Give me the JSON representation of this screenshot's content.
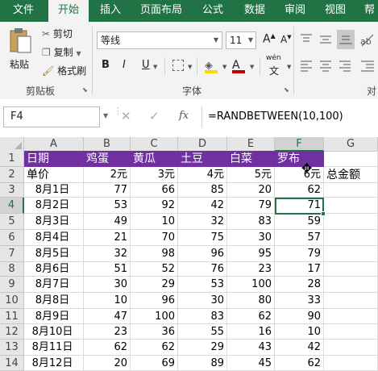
{
  "tabs": [
    "文件",
    "开始",
    "插入",
    "页面布局",
    "公式",
    "数据",
    "审阅",
    "视图",
    "帮"
  ],
  "active_tab": "开始",
  "ribbon": {
    "cut": "剪切",
    "copy": "复制",
    "format_painter": "格式刷",
    "paste": "粘贴",
    "clipboard_group": "剪贴板",
    "font_name": "等线",
    "font_size": "11",
    "grow_font": "A",
    "shrink_font": "A",
    "bold": "B",
    "italic": "I",
    "underline": "U",
    "font_color_glyph": "A",
    "wen": "wén",
    "font_group": "字体",
    "align_group": "对"
  },
  "formula_bar": {
    "name_box": "F4",
    "fx": "fx",
    "formula": "=RANDBETWEEN(10,100)"
  },
  "columns": [
    "A",
    "B",
    "C",
    "D",
    "E",
    "F",
    "G"
  ],
  "rows": [
    {
      "n": "1",
      "cells": [
        "日期",
        "鸡蛋",
        "黄瓜",
        "土豆",
        "白菜",
        "罗布",
        ""
      ]
    },
    {
      "n": "2",
      "cells": [
        "单价",
        "2元",
        "3元",
        "4元",
        "5元",
        "6元",
        "总金额"
      ]
    },
    {
      "n": "3",
      "cells": [
        "8月1日",
        "77",
        "66",
        "85",
        "20",
        "62",
        ""
      ]
    },
    {
      "n": "4",
      "cells": [
        "8月2日",
        "53",
        "92",
        "42",
        "79",
        "71",
        ""
      ]
    },
    {
      "n": "5",
      "cells": [
        "8月3日",
        "49",
        "10",
        "32",
        "83",
        "59",
        ""
      ]
    },
    {
      "n": "6",
      "cells": [
        "8月4日",
        "21",
        "70",
        "75",
        "30",
        "57",
        ""
      ]
    },
    {
      "n": "7",
      "cells": [
        "8月5日",
        "32",
        "98",
        "96",
        "95",
        "79",
        ""
      ]
    },
    {
      "n": "8",
      "cells": [
        "8月6日",
        "51",
        "52",
        "76",
        "23",
        "17",
        ""
      ]
    },
    {
      "n": "9",
      "cells": [
        "8月7日",
        "30",
        "29",
        "53",
        "100",
        "28",
        ""
      ]
    },
    {
      "n": "10",
      "cells": [
        "8月8日",
        "10",
        "96",
        "30",
        "80",
        "33",
        ""
      ]
    },
    {
      "n": "11",
      "cells": [
        "8月9日",
        "47",
        "100",
        "83",
        "62",
        "90",
        ""
      ]
    },
    {
      "n": "12",
      "cells": [
        "8月10日",
        "23",
        "36",
        "55",
        "16",
        "10",
        ""
      ]
    },
    {
      "n": "13",
      "cells": [
        "8月11日",
        "62",
        "62",
        "29",
        "43",
        "42",
        ""
      ]
    },
    {
      "n": "14",
      "cells": [
        "8月12日",
        "20",
        "69",
        "89",
        "45",
        "62",
        ""
      ]
    }
  ],
  "selected_cell": "F4",
  "colors": {
    "green": "#217346",
    "header_purple": "#7030a0",
    "font_color": "#c00000",
    "fill": "#ffd700"
  }
}
